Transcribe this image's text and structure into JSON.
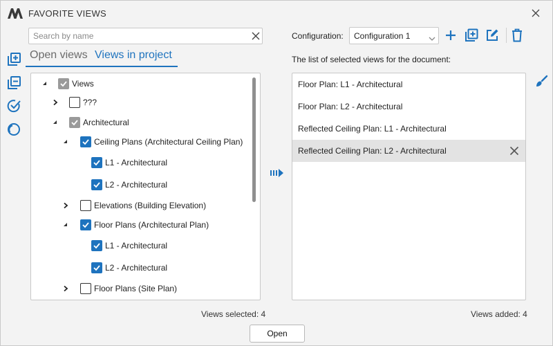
{
  "window": {
    "title": "FAVORITE VIEWS"
  },
  "search": {
    "placeholder": "Search by name",
    "value": ""
  },
  "tabs": [
    {
      "label": "Open views",
      "active": false
    },
    {
      "label": "Views in project",
      "active": true
    }
  ],
  "tree": [
    {
      "label": "Views",
      "level": 0,
      "expanded": true,
      "state": "partial"
    },
    {
      "label": "???",
      "level": 1,
      "expanded": false,
      "state": "unchecked"
    },
    {
      "label": "Architectural",
      "level": 1,
      "expanded": true,
      "state": "partial"
    },
    {
      "label": "Ceiling Plans (Architectural Ceiling Plan)",
      "level": 2,
      "expanded": true,
      "state": "checked"
    },
    {
      "label": "L1 - Architectural",
      "level": 3,
      "state": "checked"
    },
    {
      "label": "L2 - Architectural",
      "level": 3,
      "state": "checked"
    },
    {
      "label": "Elevations (Building Elevation)",
      "level": 2,
      "expanded": false,
      "state": "unchecked"
    },
    {
      "label": "Floor Plans (Architectural Plan)",
      "level": 2,
      "expanded": true,
      "state": "checked"
    },
    {
      "label": "L1 - Architectural",
      "level": 3,
      "state": "checked"
    },
    {
      "label": "L2 - Architectural",
      "level": 3,
      "state": "checked"
    },
    {
      "label": "Floor Plans (Site Plan)",
      "level": 2,
      "expanded": false,
      "state": "unchecked"
    }
  ],
  "configuration": {
    "label": "Configuration:",
    "selected": "Configuration 1"
  },
  "list": {
    "caption": "The list of selected views for the document:",
    "items": [
      {
        "label": "Floor Plan: L1 - Architectural",
        "selected": false
      },
      {
        "label": "Floor Plan: L2 - Architectural",
        "selected": false
      },
      {
        "label": "Reflected Ceiling Plan: L1 - Architectural",
        "selected": false
      },
      {
        "label": "Reflected Ceiling Plan: L2 - Architectural",
        "selected": true
      }
    ]
  },
  "status": {
    "views_selected": "Views selected: 4",
    "views_added": "Views added: 4"
  },
  "buttons": {
    "open": "Open"
  },
  "colors": {
    "accent": "#1e73be",
    "checked": "#1e73be",
    "partial": "#9a9a9a",
    "selected_row": "#e3e3e3",
    "background": "#f3f3f3"
  },
  "icons": {
    "sidebar": [
      "add-copy-icon",
      "remove-copy-icon",
      "check-all-icon",
      "uncheck-all-icon"
    ],
    "toolbar": [
      "plus-icon",
      "duplicate-icon",
      "edit-icon",
      "trash-icon"
    ],
    "other": [
      "app-logo-icon",
      "close-icon",
      "clear-search-icon",
      "transfer-arrow-icon",
      "brush-icon",
      "remove-item-icon"
    ]
  }
}
